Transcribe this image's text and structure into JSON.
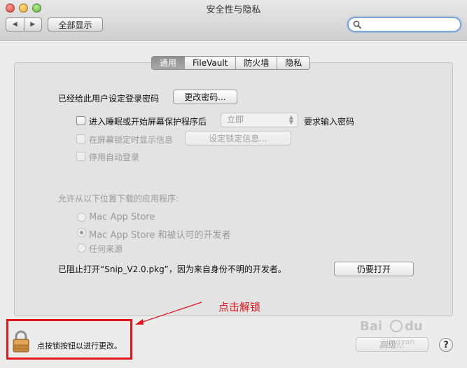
{
  "window": {
    "title": "安全性与隐私"
  },
  "toolbar": {
    "back_glyph": "◀",
    "forward_glyph": "▶",
    "show_all_label": "全部显示",
    "search_value": "",
    "search_icon": "magnifier-icon"
  },
  "tabs": [
    {
      "label": "通用",
      "selected": true
    },
    {
      "label": "FileVault",
      "selected": false
    },
    {
      "label": "防火墙",
      "selected": false
    },
    {
      "label": "隐私",
      "selected": false
    }
  ],
  "general": {
    "password_label": "已经给此用户设定登录密码",
    "change_password_button": "更改密码...",
    "require_password_label": "进入睡眠或开始屏幕保护程序后",
    "require_password_select": "立即",
    "require_password_suffix": "要求输入密码",
    "show_message_label": "在屏幕锁定时显示信息",
    "set_lock_message_button": "设定锁定信息...",
    "disable_autologin_label": "停用自动登录"
  },
  "downloads": {
    "heading": "允许从以下位置下载的应用程序:",
    "options": [
      {
        "label": "Mac App Store",
        "selected": false
      },
      {
        "label": "Mac App Store 和被认可的开发者",
        "selected": true
      },
      {
        "label": "任何来源",
        "selected": false
      }
    ],
    "blocked_message": "已阻止打开“Snip_V2.0.pkg”，因为来自身份不明的开发者。",
    "open_anyway_button": "仍要打开"
  },
  "footer": {
    "lock_text": "点按锁按钮以进行更改。",
    "advanced_button": "高级...",
    "help_glyph": "?"
  },
  "annotation": {
    "text": "点击解锁",
    "color": "#e4161b"
  },
  "watermark": {
    "text": "Bai",
    "text2": "jingyan",
    "text3": "du"
  }
}
